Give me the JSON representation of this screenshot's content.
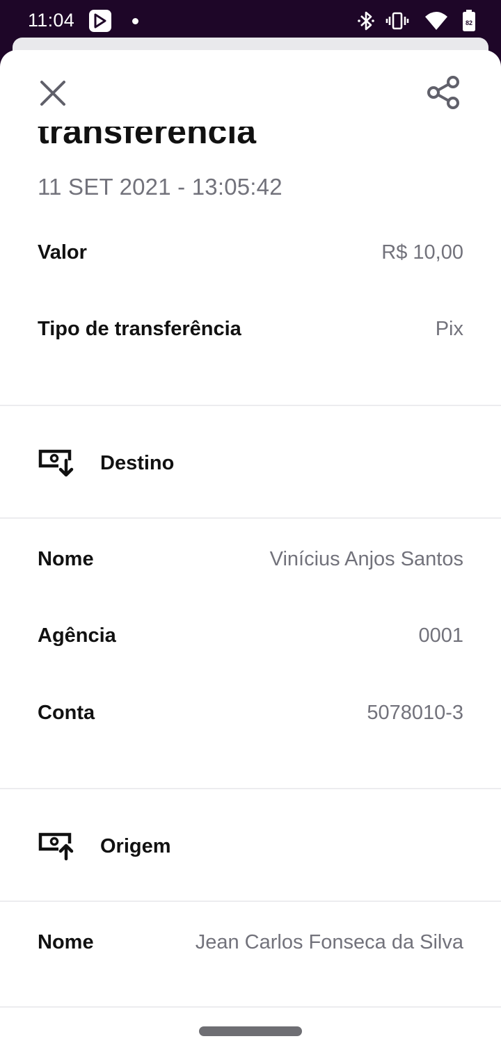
{
  "status_bar": {
    "time": "11:04",
    "app_icon": "play-app-icon",
    "battery_level": "82",
    "icons": [
      "bluetooth-icon",
      "vibrate-icon",
      "wifi-icon",
      "battery-icon"
    ]
  },
  "header": {
    "close_icon": "close-icon",
    "share_icon": "share-icon",
    "title": "transferência",
    "date": "11 SET 2021 - 13:05:42"
  },
  "summary": {
    "valor_label": "Valor",
    "valor_value": "R$ 10,00",
    "tipo_label": "Tipo de transferência",
    "tipo_value": "Pix"
  },
  "destino": {
    "title": "Destino",
    "icon": "receive-money-icon",
    "nome_label": "Nome",
    "nome_value": "Vinícius Anjos Santos",
    "agencia_label": "Agência",
    "agencia_value": "0001",
    "conta_label": "Conta",
    "conta_value": "5078010-3"
  },
  "origem": {
    "title": "Origem",
    "icon": "send-money-icon",
    "nome_label": "Nome",
    "nome_value": "Jean Carlos Fonseca da Silva"
  },
  "colors": {
    "status_bar_bg": "#1e0628",
    "text_primary": "#111111",
    "text_secondary": "#72727b",
    "divider": "#ececef"
  }
}
